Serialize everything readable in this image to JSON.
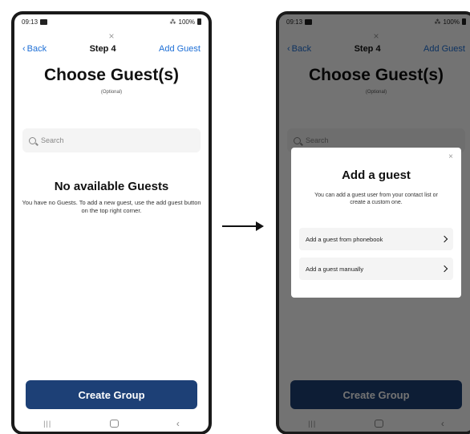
{
  "status_bar": {
    "time": "09:13",
    "battery": "100%"
  },
  "close_symbol": "×",
  "nav": {
    "back_label": "Back",
    "step_label": "Step 4",
    "add_guest_label": "Add Guest"
  },
  "page": {
    "title": "Choose Guest(s)",
    "subtitle": "(Optional)"
  },
  "search": {
    "placeholder": "Search"
  },
  "empty_state": {
    "title": "No available Guests",
    "description": "You have no Guests. To add a new guest, use the add guest button on the top right corner."
  },
  "create_button": {
    "label": "Create Group"
  },
  "dialog": {
    "close_symbol": "×",
    "title": "Add a guest",
    "description": "You can add a guest user from your contact list or create a custom one.",
    "options": [
      {
        "label": "Add a guest from phonebook",
        "icon": "chevron-right-icon"
      },
      {
        "label": "Add a guest manually",
        "icon": "chevron-right-icon"
      }
    ]
  },
  "icons": {
    "search": "search-icon",
    "back": "chevron-left-icon",
    "recents": "recents-icon",
    "home": "home-icon",
    "nav_back": "nav-back-icon"
  },
  "colors": {
    "accent": "#1e6fd6",
    "primary_button": "#1d4076",
    "overlay": "rgba(0,0,0,0.55)"
  }
}
